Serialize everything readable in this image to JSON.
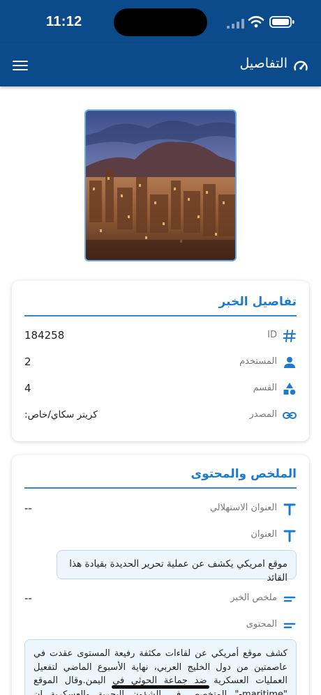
{
  "status_bar": {
    "time": "11:12"
  },
  "app_bar": {
    "title": "التفاصيل",
    "title_icon": "gauge-icon",
    "menu_icon": "menu-icon"
  },
  "image": {
    "icon": "city-photo"
  },
  "details_card": {
    "title": "تفاصيل الخبر",
    "rows": [
      {
        "icon": "hash-icon",
        "label": "ID",
        "value": "184258"
      },
      {
        "icon": "person-icon",
        "label": "المستخدم",
        "value": "2"
      },
      {
        "icon": "category-icon",
        "label": "القسم",
        "value": "4"
      },
      {
        "icon": "link-icon",
        "label": "المصدر",
        "value": ":كريتر سكاي/خاص"
      }
    ]
  },
  "content_card": {
    "title": "الملخص والمحتوى",
    "intro_title": {
      "label": "العنوان الاستهلالي",
      "value": "--"
    },
    "title_field": {
      "label": "العنوان",
      "value": "موقع امريكي يكشف عن عملية تحرير الحديدة بقيادة هذا القائد"
    },
    "summary": {
      "label": "ملخص الخبر",
      "value": "--"
    },
    "content": {
      "label": "المحتوى",
      "value": "كشف موقع أمريكي عن لقاءات مكثفة رفيعة المستوى عقدت في عاصمتين من دول الخليج العربي، نهاية الأسبوع الماضي لتفعيل العمليات العسكرية ضد جماعة الحوثي في اليمن.وقال الموقع \"maritime-\" المتخصص في الشؤون البحرية والعسكرية إن اللقاءات"
    }
  },
  "colors": {
    "primary": "#0b4a8b",
    "accent": "#1c7bd0"
  }
}
